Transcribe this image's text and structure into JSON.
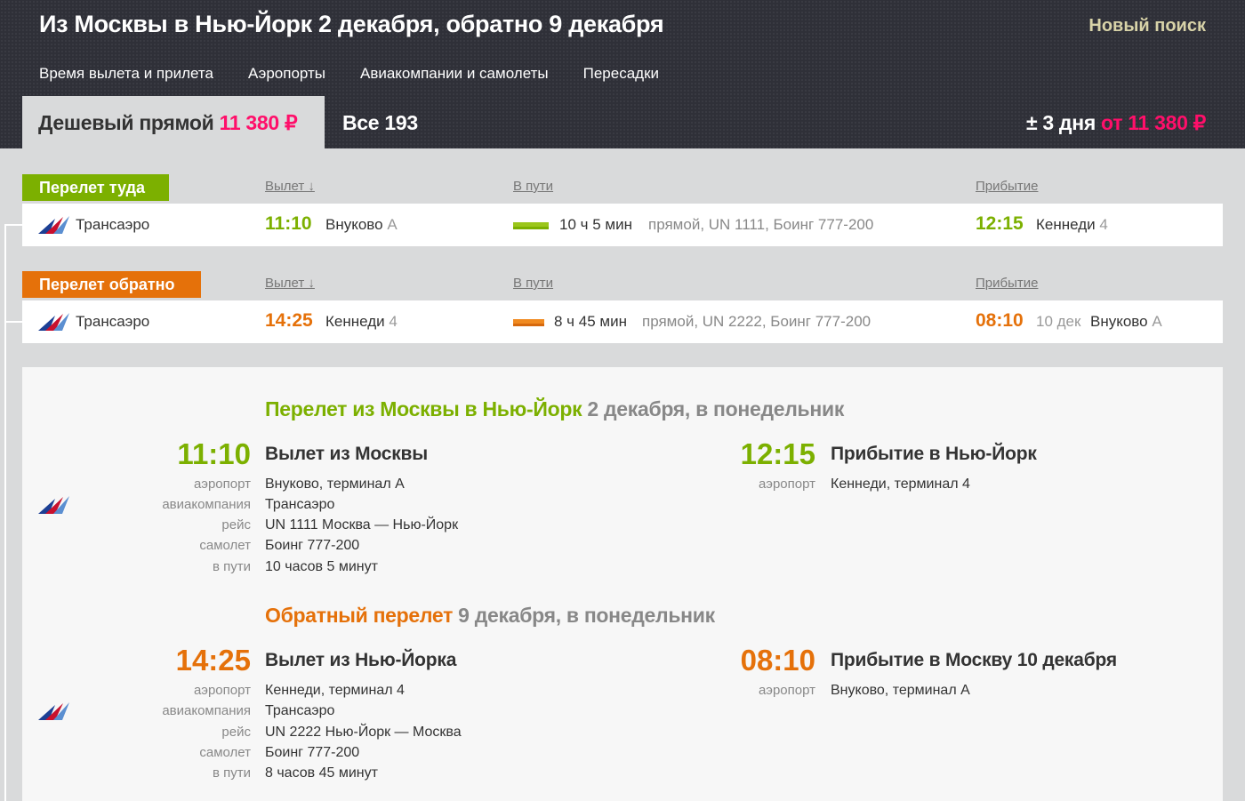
{
  "header": {
    "title": "Из Москвы в Нью-Йорк 2 декабря, обратно 9 декабря",
    "new_search": "Новый поиск",
    "filters": [
      "Время вылета и прилета",
      "Аэропорты",
      "Авиакомпании и самолеты",
      "Пересадки"
    ],
    "tab_cheap_label": "Дешевый прямой",
    "tab_cheap_price": "11 380 ₽",
    "tab_all": "Все 193",
    "range_label": "± 3 дня",
    "range_from": "от",
    "range_price": "11 380 ₽"
  },
  "columns": {
    "departure": "Вылет ↓",
    "duration": "В пути",
    "arrival": "Прибытие"
  },
  "outbound": {
    "label": "Перелет туда",
    "airline": "Трансаэро",
    "dep_time": "11:10",
    "dep_airport": "Внуково",
    "dep_terminal": "A",
    "duration": "10 ч 5 мин",
    "info": "прямой, UN 1111, Боинг 777-200",
    "arr_time": "12:15",
    "arr_airport": "Кеннеди",
    "arr_terminal": "4"
  },
  "return": {
    "label": "Перелет обратно",
    "airline": "Трансаэро",
    "dep_time": "14:25",
    "dep_airport": "Кеннеди",
    "dep_terminal": "4",
    "duration": "8 ч 45 мин",
    "info": "прямой, UN 2222, Боинг 777-200",
    "arr_time": "08:10",
    "arr_date": "10 дек",
    "arr_airport": "Внуково",
    "arr_terminal": "A"
  },
  "details": {
    "outbound": {
      "heading_hl": "Перелет из Москвы в Нью-Йорк",
      "heading_rest": "2 декабря, в понедельник",
      "dep_time": "11:10",
      "dep_title": "Вылет из Москвы",
      "arr_time": "12:15",
      "arr_title": "Прибытие в Нью-Йорк",
      "keys": [
        "аэропорт",
        "авиакомпания",
        "рейс",
        "самолет",
        "в пути"
      ],
      "values": [
        "Внуково, терминал A",
        "Трансаэро",
        "UN 1111 Москва — Нью-Йорк",
        "Боинг 777-200",
        "10 часов 5 минут"
      ],
      "arr_key": "аэропорт",
      "arr_value": "Кеннеди, терминал 4"
    },
    "return": {
      "heading_hl": "Обратный перелет",
      "heading_rest": "9 декабря, в понедельник",
      "dep_time": "14:25",
      "dep_title": "Вылет из Нью-Йорка",
      "arr_time": "08:10",
      "arr_title": "Прибытие в Москву 10 декабря",
      "keys": [
        "аэропорт",
        "авиакомпания",
        "рейс",
        "самолет",
        "в пути"
      ],
      "values": [
        "Кеннеди, терминал 4",
        "Трансаэро",
        "UN 2222 Нью-Йорк — Москва",
        "Боинг 777-200",
        "8 часов 45 минут"
      ],
      "arr_key": "аэропорт",
      "arr_value": "Внуково, терминал A"
    }
  },
  "colors": {
    "outbound": "#7cb000",
    "return": "#e5710a",
    "price": "#ff0f6a",
    "header_bg": "#2f3038"
  },
  "icons": {
    "airline_logo": "transaero-logo-icon"
  }
}
